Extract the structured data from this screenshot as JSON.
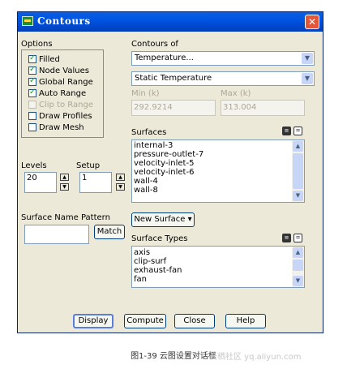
{
  "window": {
    "title": "Contours",
    "close_glyph": "✕"
  },
  "options": {
    "label": "Options",
    "items": [
      {
        "label": "Filled",
        "checked": true,
        "enabled": true
      },
      {
        "label": "Node Values",
        "checked": true,
        "enabled": true
      },
      {
        "label": "Global Range",
        "checked": true,
        "enabled": true
      },
      {
        "label": "Auto Range",
        "checked": true,
        "enabled": true
      },
      {
        "label": "Clip to Range",
        "checked": false,
        "enabled": false
      },
      {
        "label": "Draw Profiles",
        "checked": false,
        "enabled": true
      },
      {
        "label": "Draw Mesh",
        "checked": false,
        "enabled": true
      }
    ]
  },
  "contours_of": {
    "label": "Contours of",
    "category": "Temperature...",
    "variable": "Static Temperature"
  },
  "range": {
    "min_label": "Min (k)",
    "min_value": "292.9214",
    "max_label": "Max (k)",
    "max_value": "313.004"
  },
  "surfaces": {
    "label": "Surfaces",
    "items": [
      "internal-3",
      "pressure-outlet-7",
      "velocity-inlet-5",
      "velocity-inlet-6",
      "wall-4",
      "wall-8"
    ]
  },
  "levels": {
    "label": "Levels",
    "value": "20"
  },
  "setup": {
    "label": "Setup",
    "value": "1"
  },
  "pattern": {
    "label": "Surface Name Pattern",
    "value": "",
    "match_label": "Match"
  },
  "new_surface": {
    "label": "New Surface ▾"
  },
  "surface_types": {
    "label": "Surface Types",
    "items": [
      "axis",
      "clip-surf",
      "exhaust-fan",
      "fan"
    ]
  },
  "buttons": {
    "display": "Display",
    "compute": "Compute",
    "close": "Close",
    "help": "Help"
  },
  "caption": "图1-39   云图设置对话框",
  "watermark": "云栖社区 yq.aliyun.com",
  "icons": {
    "select_all": "select-all-icon",
    "deselect_all": "deselect-all-icon"
  },
  "colors": {
    "titlebar": "#0054e3",
    "dialog_bg": "#ece9d8",
    "close": "#e2563a"
  }
}
